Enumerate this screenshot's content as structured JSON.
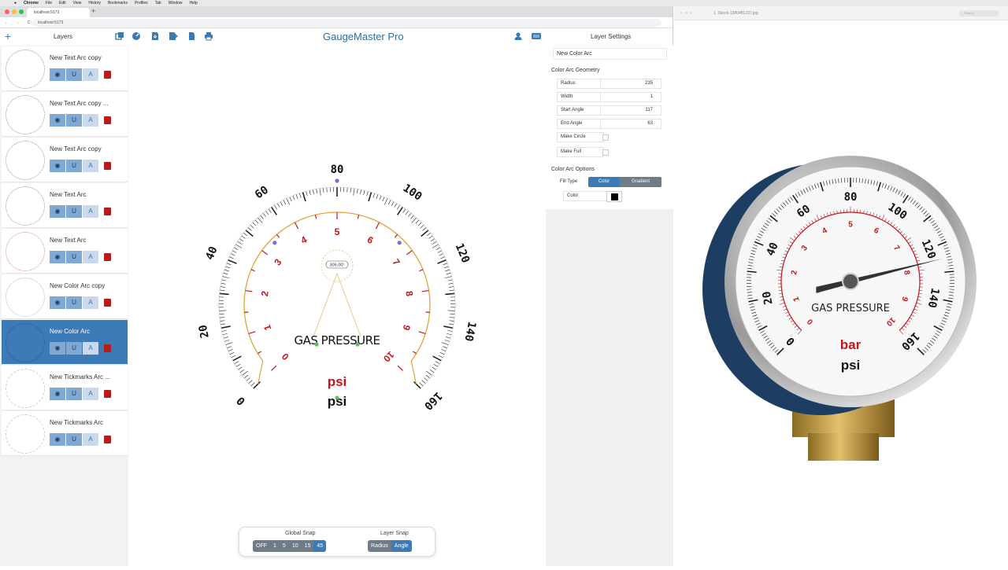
{
  "menubar": {
    "items": [
      "Chrome",
      "File",
      "Edit",
      "View",
      "History",
      "Bookmarks",
      "Profiles",
      "Tab",
      "Window",
      "Help"
    ]
  },
  "browser": {
    "tab_title": "localhost:5173",
    "new_tab": "+",
    "url": "localhost:5173",
    "nav": "← → C"
  },
  "app": {
    "title": "GaugeMaster Pro",
    "layers_title": "Layers",
    "layer_settings_title": "Layer Settings",
    "add_layer": "+"
  },
  "layers": [
    {
      "name": "New Text Arc copy",
      "selected": false
    },
    {
      "name": "New Text Arc copy ...",
      "selected": false
    },
    {
      "name": "New Text Arc copy",
      "selected": false
    },
    {
      "name": "New Text Arc",
      "selected": false
    },
    {
      "name": "New Text Arc",
      "selected": false
    },
    {
      "name": "New Color Arc copy",
      "selected": false
    },
    {
      "name": "New Color Arc",
      "selected": true
    },
    {
      "name": "New Tickmarks Arc ...",
      "selected": false
    },
    {
      "name": "New Tickmarks Arc",
      "selected": false
    }
  ],
  "layer_button_glyphs": {
    "eye": "◉",
    "magnet": "U",
    "text": "A"
  },
  "settings": {
    "name_value": "New Color Arc",
    "geometry_title": "Color Arc Geometry",
    "radius_label": "Radius",
    "radius_value": "235",
    "width_label": "Width",
    "width_value": "1",
    "start_label": "Start Angle",
    "start_value": "117",
    "end_label": "End Angle",
    "end_value": "63",
    "make_circle_label": "Make Circle",
    "make_full_label": "Make Full",
    "options_title": "Color Arc Options",
    "fill_type_label": "Fill Type",
    "fill_color": "Color",
    "fill_gradient": "Gradient",
    "color_label": "Color",
    "color_value": "#000000"
  },
  "gauge": {
    "psi_labels": [
      "0",
      "20",
      "40",
      "60",
      "80",
      "100",
      "120",
      "140",
      "160"
    ],
    "bar_labels": [
      "0",
      "1",
      "2",
      "3",
      "4",
      "5",
      "6",
      "7",
      "8",
      "9",
      "10"
    ],
    "text_arc": "GAS PRESSURE",
    "unit_red": "psi",
    "unit_black": "psi",
    "angle_readout": "306.00°"
  },
  "snap": {
    "global_title": "Global Snap",
    "global_options": [
      "OFF",
      "1",
      "5",
      "10",
      "15",
      "45"
    ],
    "global_active": "45",
    "layer_title": "Layer Snap",
    "layer_options": [
      "Radius",
      "Angle"
    ],
    "layer_active": "Angle"
  },
  "preview": {
    "filename": "1. iStock-1380481237.jpg",
    "search_placeholder": "Search",
    "psi_labels": [
      "0",
      "20",
      "40",
      "60",
      "80",
      "100",
      "120",
      "140",
      "160"
    ],
    "bar_labels": [
      "0",
      "1",
      "2",
      "3",
      "4",
      "5",
      "6",
      "7",
      "8",
      "9",
      "10"
    ],
    "text": "GAS PRESSURE",
    "unit_bar": "bar",
    "unit_psi": "psi"
  },
  "colors": {
    "accent": "#3d7ab8",
    "red": "#c0161e",
    "orange": "#e3a33a",
    "navy": "#1d3d63"
  }
}
